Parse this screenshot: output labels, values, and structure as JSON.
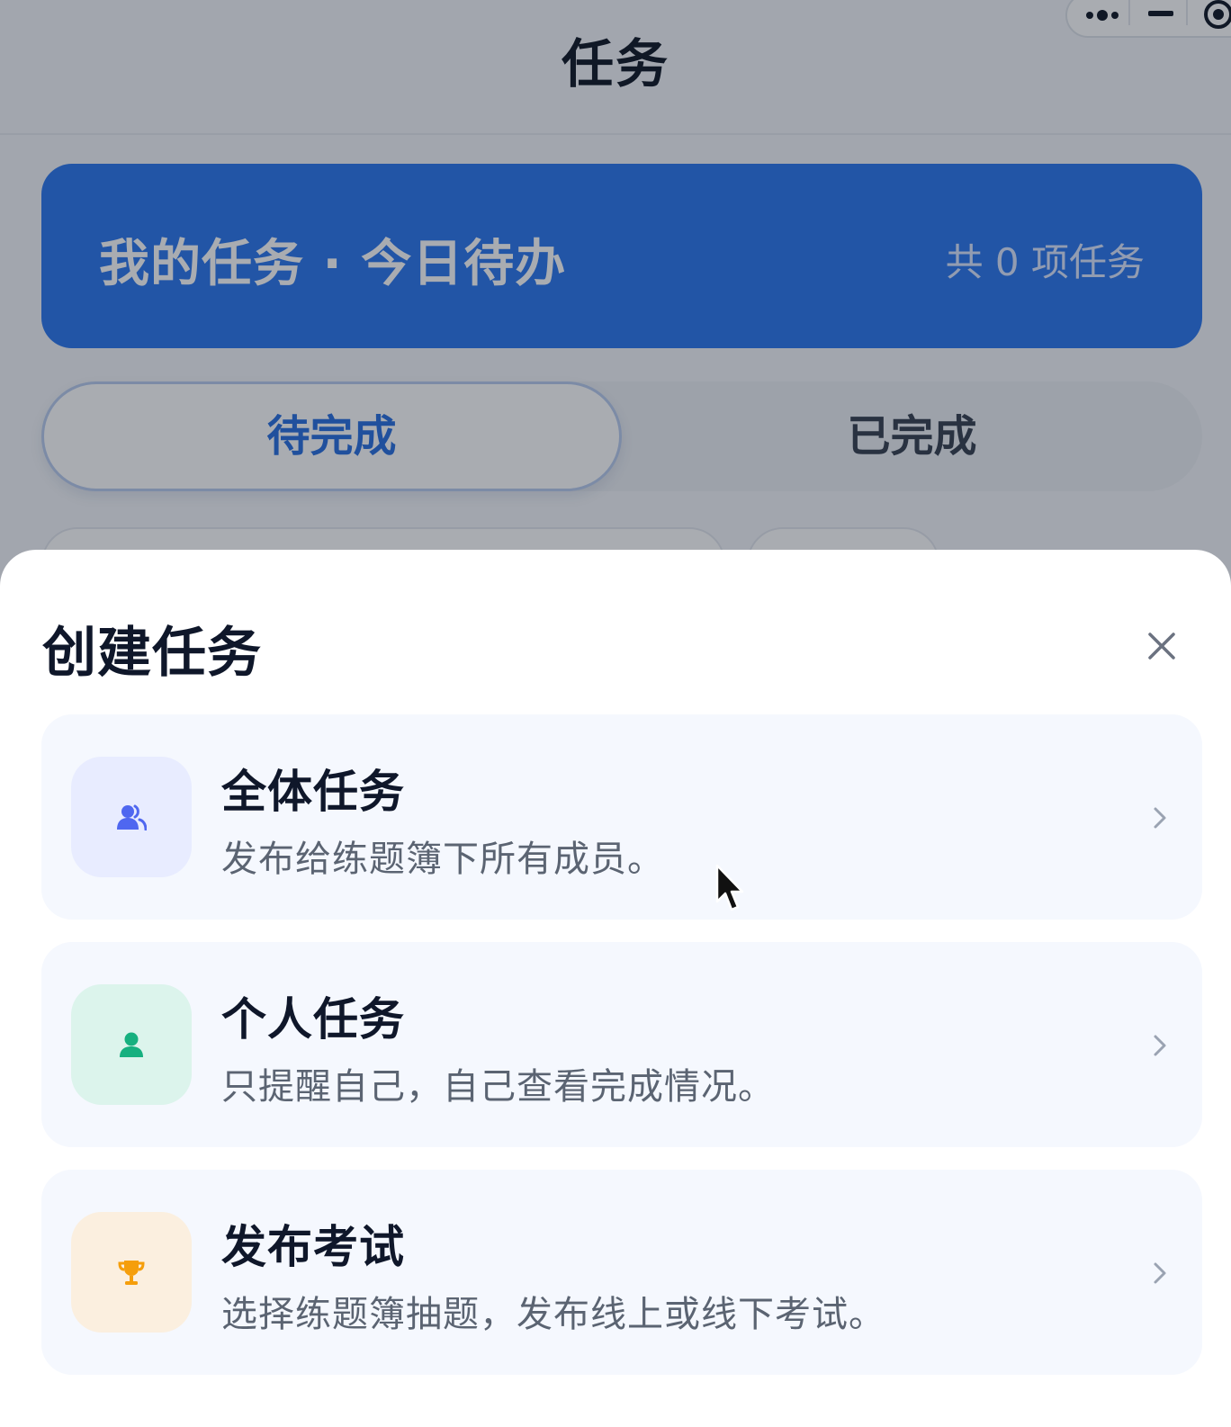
{
  "header": {
    "title": "任务"
  },
  "capsule": {
    "more_icon": "more-dots-icon",
    "minimize_icon": "minimize-icon",
    "close_icon": "target-close-icon"
  },
  "banner": {
    "title": "我的任务 · 今日待办",
    "count": "共 0 项任务",
    "color": "#2c77ee"
  },
  "tabs": [
    {
      "label": "待完成",
      "active": true
    },
    {
      "label": "已完成",
      "active": false
    }
  ],
  "sheet": {
    "title": "创建任务",
    "close_icon": "close-icon",
    "options": [
      {
        "title": "全体任务",
        "desc": "发布给练题簿下所有成员。",
        "icon": "users-icon",
        "icon_color": "#4f67f0",
        "icon_bg": "#e8ecff"
      },
      {
        "title": "个人任务",
        "desc": "只提醒自己，自己查看完成情况。",
        "icon": "user-icon",
        "icon_color": "#16b07f",
        "icon_bg": "#dcf4ec"
      },
      {
        "title": "发布考试",
        "desc": "选择练题簿抽题，发布线上或线下考试。",
        "icon": "trophy-icon",
        "icon_color": "#f59e0b",
        "icon_bg": "#fbefdf"
      }
    ]
  }
}
